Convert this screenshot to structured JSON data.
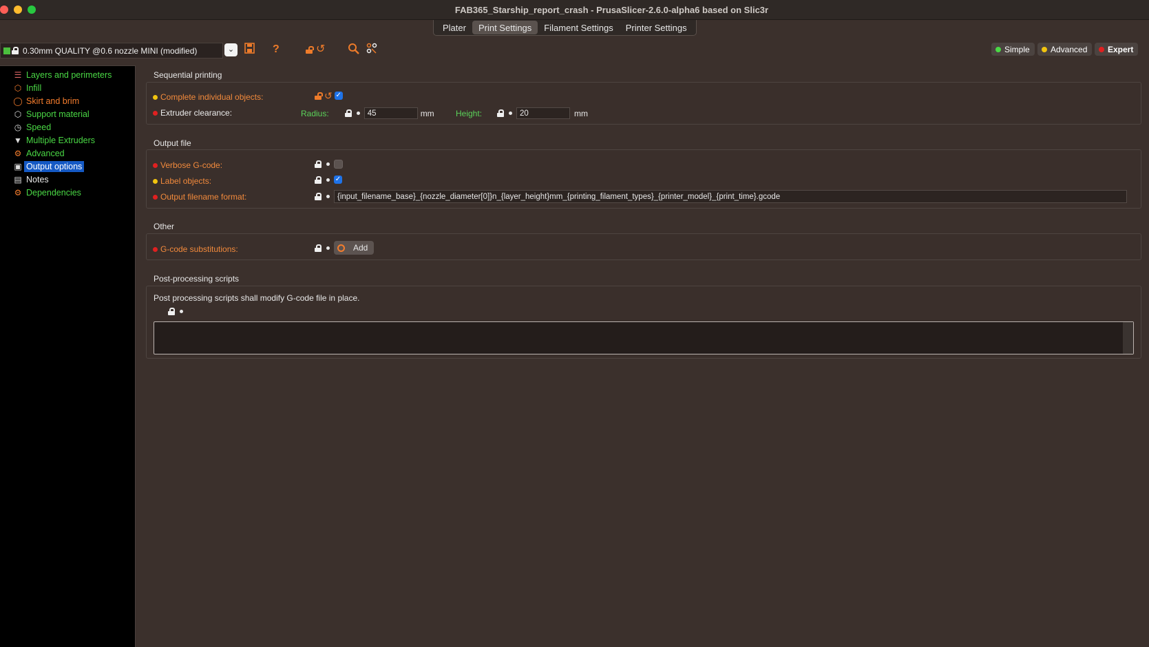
{
  "window": {
    "title": "FAB365_Starship_report_crash - PrusaSlicer-2.6.0-alpha6 based on Slic3r"
  },
  "tabs": [
    {
      "label": "Plater"
    },
    {
      "label": "Print Settings"
    },
    {
      "label": "Filament Settings"
    },
    {
      "label": "Printer Settings"
    }
  ],
  "toolbar": {
    "preset": "0.30mm QUALITY @0.6 nozzle MINI (modified)",
    "icons": [
      "save-icon",
      "help-icon",
      "unlock-icon",
      "undo-icon",
      "search-icon",
      "compare-icon"
    ]
  },
  "modes": [
    {
      "label": "Simple",
      "color": "#4ad845"
    },
    {
      "label": "Advanced",
      "color": "#f1c40f"
    },
    {
      "label": "Expert",
      "color": "#e02020"
    }
  ],
  "sidebar": {
    "items": [
      {
        "label": "Layers and perimeters",
        "color": "green",
        "icon": "layers-icon"
      },
      {
        "label": "Infill",
        "color": "green",
        "icon": "infill-icon"
      },
      {
        "label": "Skirt and brim",
        "color": "orange",
        "icon": "skirt-icon"
      },
      {
        "label": "Support material",
        "color": "green",
        "icon": "support-icon"
      },
      {
        "label": "Speed",
        "color": "green",
        "icon": "speed-icon"
      },
      {
        "label": "Multiple Extruders",
        "color": "green",
        "icon": "funnel-icon"
      },
      {
        "label": "Advanced",
        "color": "green",
        "icon": "wrench-icon"
      },
      {
        "label": "Output options",
        "color": "white",
        "icon": "output-icon",
        "selected": true
      },
      {
        "label": "Notes",
        "color": "white",
        "icon": "notes-icon"
      },
      {
        "label": "Dependencies",
        "color": "green",
        "icon": "wrench-icon"
      }
    ]
  },
  "sequential": {
    "title": "Sequential printing",
    "complete_label": "Complete individual objects:",
    "complete_checked": true,
    "clearance_label": "Extruder clearance:",
    "radius_label": "Radius:",
    "radius_value": "45",
    "radius_unit": "mm",
    "height_label": "Height:",
    "height_value": "20",
    "height_unit": "mm"
  },
  "output_file": {
    "title": "Output file",
    "verbose_label": "Verbose G-code:",
    "verbose_checked": false,
    "label_objects_label": "Label objects:",
    "label_objects_checked": true,
    "filename_label": "Output filename format:",
    "filename_value": "{input_filename_base}_{nozzle_diameter[0]}n_{layer_height}mm_{printing_filament_types}_{printer_model}_{print_time}.gcode"
  },
  "other": {
    "title": "Other",
    "substitutions_label": "G-code substitutions:",
    "add_label": "Add"
  },
  "post_processing": {
    "title": "Post-processing scripts",
    "description": "Post processing scripts shall modify G-code file in place.",
    "value": ""
  }
}
